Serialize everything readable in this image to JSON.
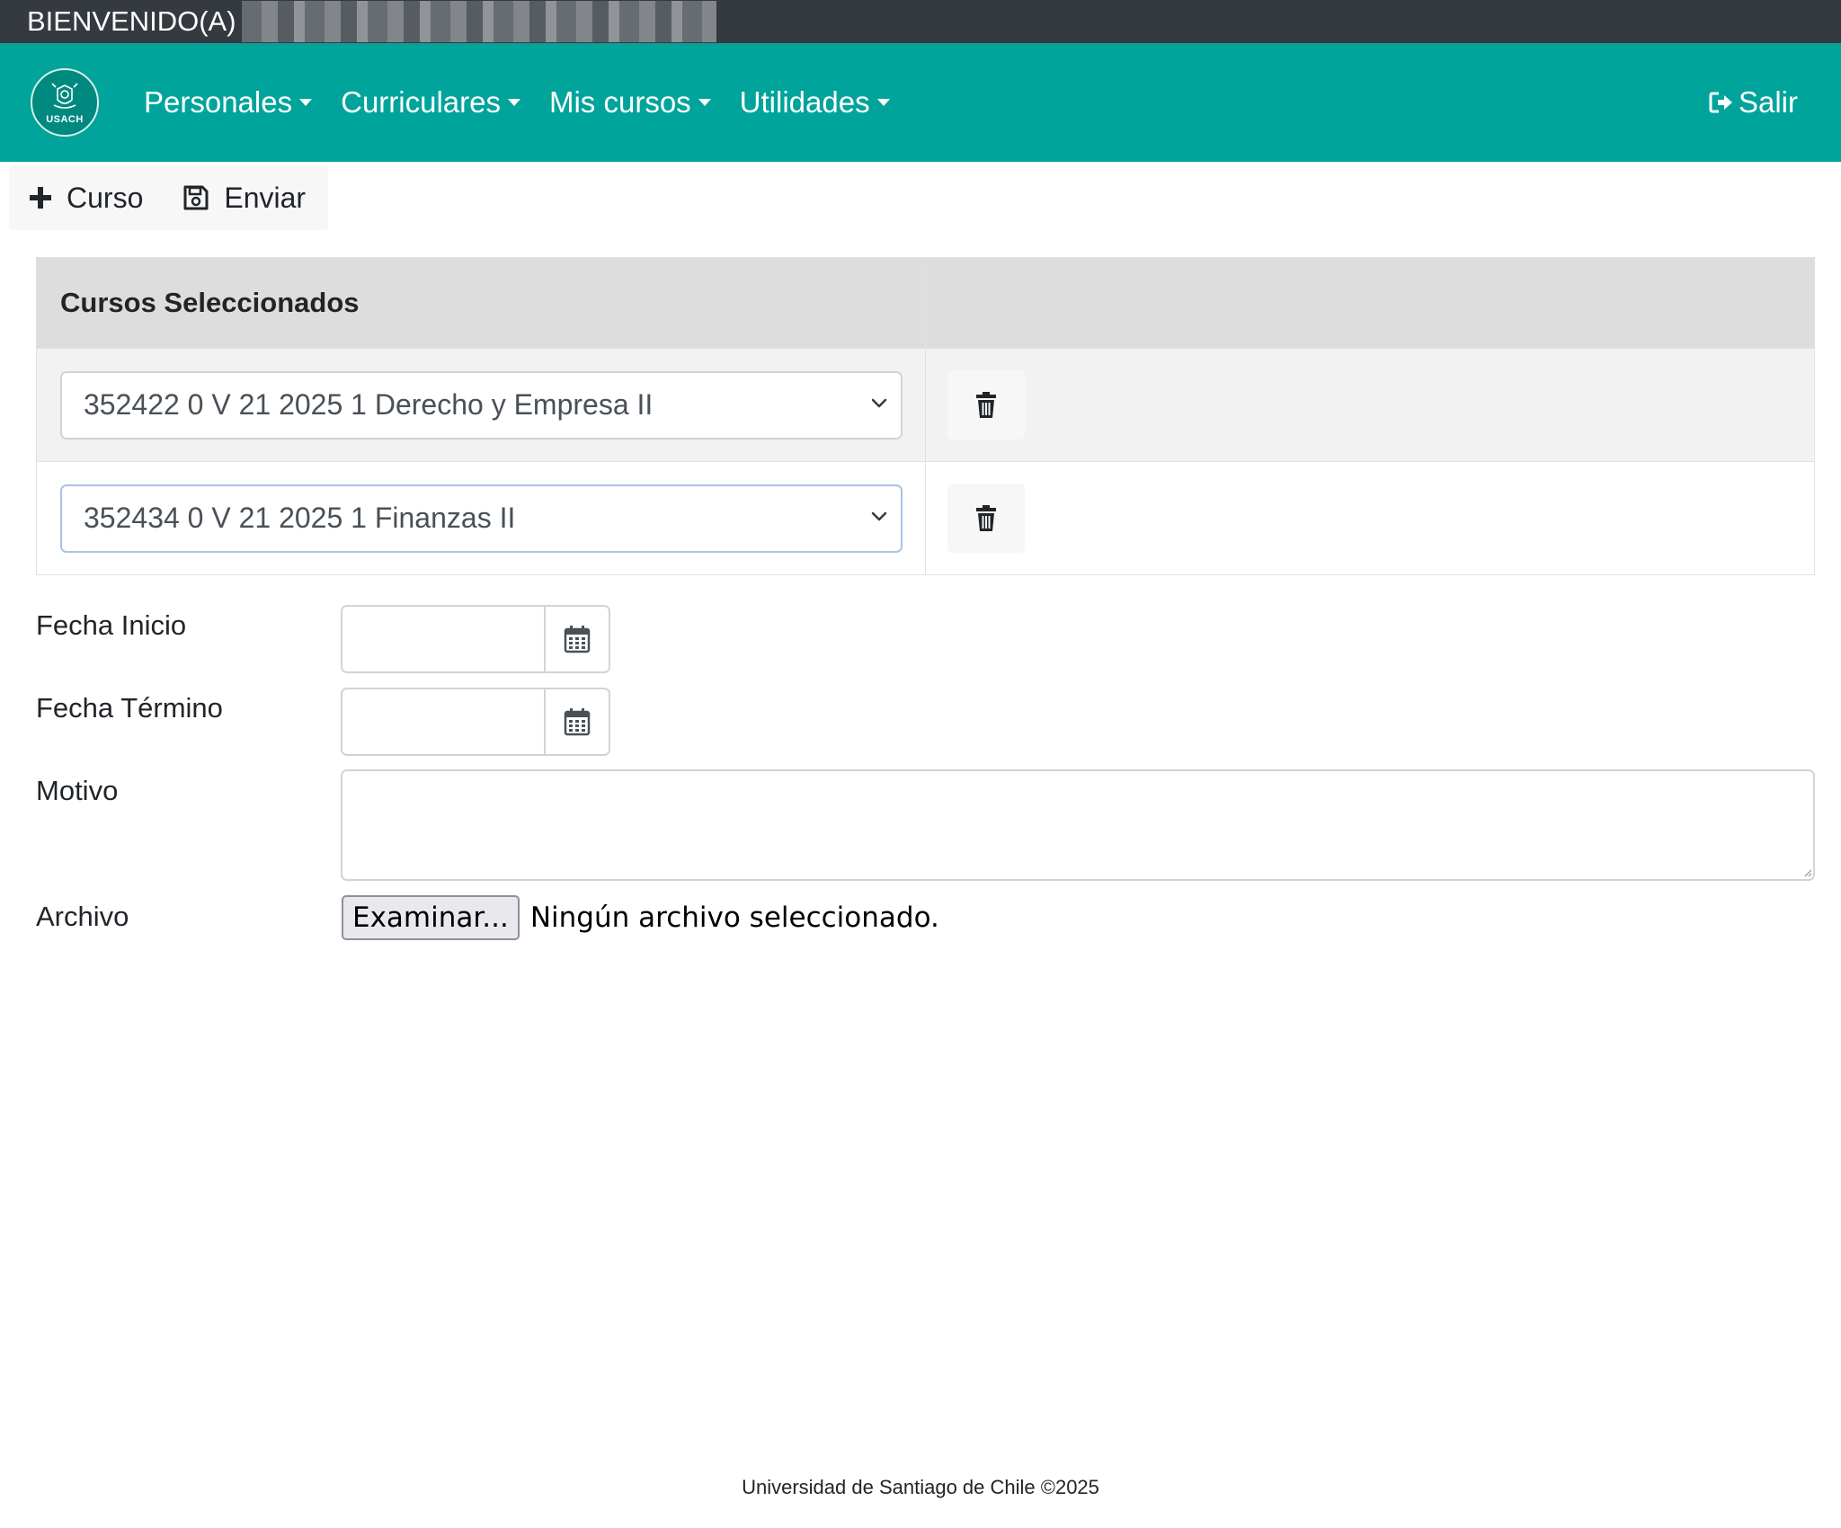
{
  "welcome": {
    "text": "BIENVENIDO(A)"
  },
  "navbar": {
    "logo_text": "USACH",
    "items": [
      {
        "label": "Personales"
      },
      {
        "label": "Curriculares"
      },
      {
        "label": "Mis cursos"
      },
      {
        "label": "Utilidades"
      }
    ],
    "logout_label": "Salir",
    "background_color": "#00a49a"
  },
  "toolbar": {
    "add_course_label": "Curso",
    "send_label": "Enviar"
  },
  "table": {
    "header": "Cursos Seleccionados",
    "rows": [
      {
        "selected": "352422 0 V 21 2025 1 Derecho y Empresa II"
      },
      {
        "selected": "352434 0 V 21 2025 1 Finanzas II"
      }
    ]
  },
  "form": {
    "fecha_inicio_label": "Fecha Inicio",
    "fecha_termino_label": "Fecha Término",
    "motivo_label": "Motivo",
    "archivo_label": "Archivo",
    "file_button_label": "Examinar...",
    "file_status": "Ningún archivo seleccionado."
  },
  "footer": {
    "text": "Universidad de Santiago de Chile ©2025"
  }
}
